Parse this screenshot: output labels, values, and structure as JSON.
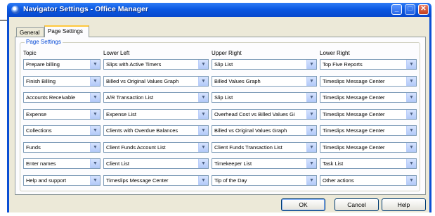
{
  "window": {
    "title": "Navigator Settings - Office Manager"
  },
  "tabs": [
    {
      "label": "General"
    },
    {
      "label": "Page Settings"
    }
  ],
  "group_label": "Page Settings",
  "columns": [
    "Topic",
    "Lower Left",
    "Upper Right",
    "Lower Right"
  ],
  "rows": [
    [
      "Prepare billing",
      "Slips with Active Timers",
      "Slip List",
      "Top Five Reports"
    ],
    [
      "Finish Billing",
      "Billed vs Original Values Graph",
      "Billed Values Graph",
      "Timeslips Message Center"
    ],
    [
      "Accounts Receivable",
      "A/R Transaction List",
      "Slip List",
      "Timeslips Message Center"
    ],
    [
      "Expense",
      "Expense List",
      "Overhead Cost vs Billed Values Gi",
      "Timeslips Message Center"
    ],
    [
      "Collections",
      "Clients with Overdue Balances",
      "Billed vs Original Values Graph",
      "Timeslips Message Center"
    ],
    [
      "Funds",
      "Client Funds Account List",
      "Client Funds Transaction List",
      "Timeslips Message Center"
    ],
    [
      "Enter names",
      "Client List",
      "Timekeeper List",
      "Task List"
    ],
    [
      "Help and support",
      "Timeslips Message Center",
      "Tip of the Day",
      "Other actions"
    ]
  ],
  "buttons": {
    "ok": "OK",
    "cancel": "Cancel",
    "help": "Help"
  },
  "icons": {
    "app": "navigator-icon",
    "dropdown": "chevron-down-icon"
  },
  "colors": {
    "title_bar": "#0a58e2",
    "dialog_bg": "#ece9d8",
    "group_label": "#0046d5"
  }
}
